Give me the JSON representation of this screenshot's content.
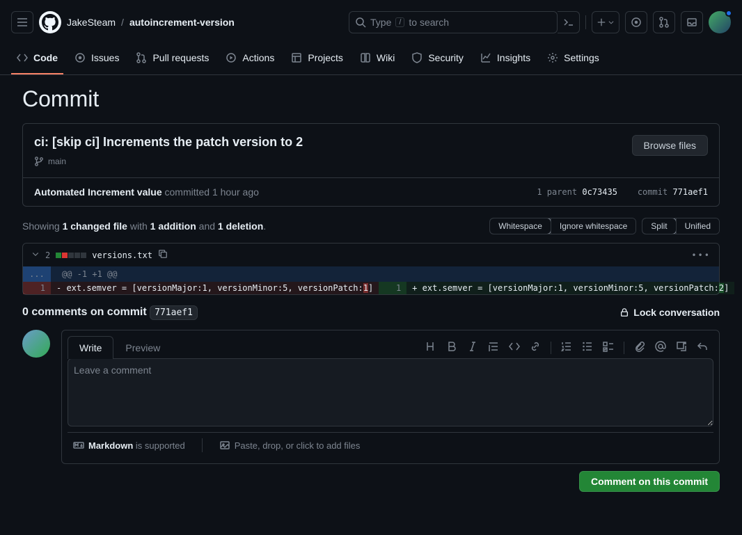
{
  "header": {
    "owner": "JakeSteam",
    "repo": "autoincrement-version",
    "search_prefix": "Type",
    "search_key": "/",
    "search_suffix": "to search"
  },
  "tabs": [
    {
      "label": "Code",
      "active": true
    },
    {
      "label": "Issues"
    },
    {
      "label": "Pull requests"
    },
    {
      "label": "Actions"
    },
    {
      "label": "Projects"
    },
    {
      "label": "Wiki"
    },
    {
      "label": "Security"
    },
    {
      "label": "Insights"
    },
    {
      "label": "Settings"
    }
  ],
  "page_title": "Commit",
  "commit": {
    "title": "ci: [skip ci] Increments the patch version to 2",
    "branch": "main",
    "browse_btn": "Browse files",
    "author": "Automated Increment value",
    "action": "committed",
    "time": "1 hour ago",
    "parent_label": "1 parent",
    "parent_sha": "0c73435",
    "commit_label": "commit",
    "sha": "771aef1"
  },
  "stats": {
    "prefix": "Showing",
    "files": "1 changed file",
    "mid1": "with",
    "adds": "1 addition",
    "mid2": "and",
    "dels": "1 deletion",
    "suffix": "."
  },
  "toggles": {
    "whitespace": "Whitespace",
    "ignore_ws": "Ignore whitespace",
    "split": "Split",
    "unified": "Unified"
  },
  "file": {
    "change_count": "2",
    "name": "versions.txt",
    "hunk": "@@ -1 +1 @@",
    "old_lnum": "1",
    "new_lnum": "1",
    "old_prefix": "- ext.semver = [versionMajor:1, versionMinor:5, versionPatch:",
    "old_diff": "1",
    "old_suffix": "]",
    "new_prefix": "+ ext.semver = [versionMajor:1, versionMinor:5, versionPatch:",
    "new_diff": "2",
    "new_suffix": "]"
  },
  "comments": {
    "header_prefix": "0 comments on commit",
    "sha": "771aef1",
    "lock": "Lock conversation",
    "write_tab": "Write",
    "preview_tab": "Preview",
    "placeholder": "Leave a comment",
    "md_support_prefix": "Markdown",
    "md_support_suffix": "is supported",
    "paste": "Paste, drop, or click to add files",
    "submit": "Comment on this commit"
  }
}
